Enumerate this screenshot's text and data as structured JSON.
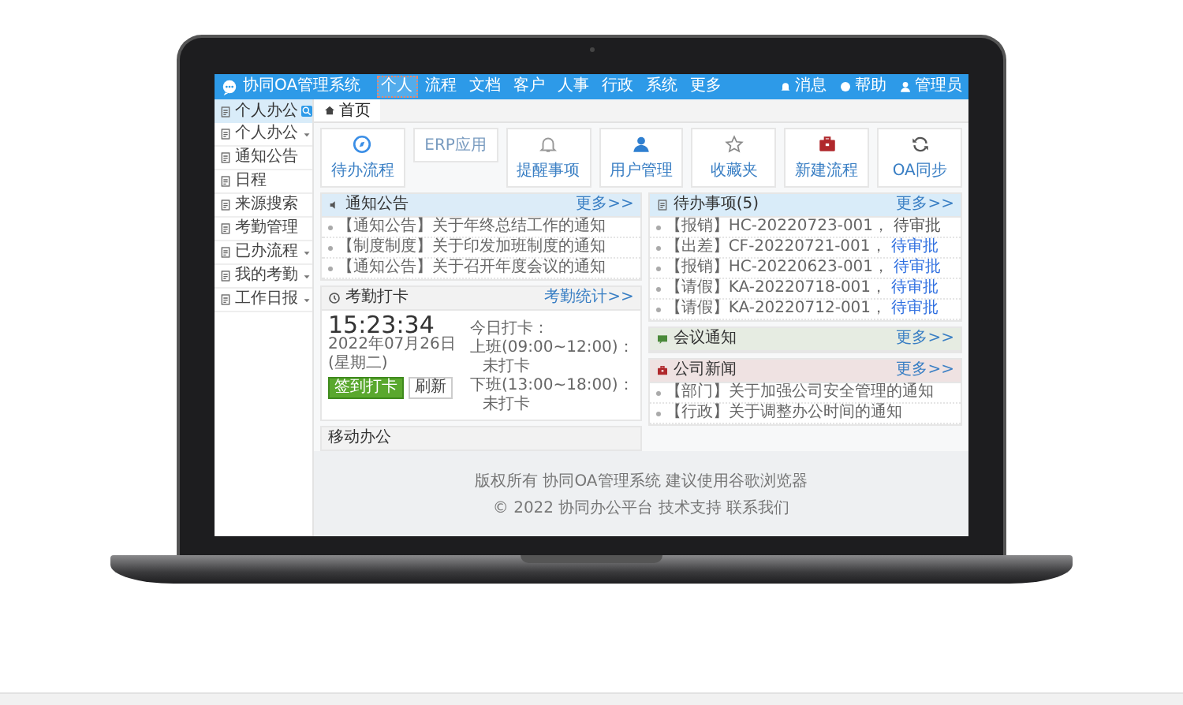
{
  "header": {
    "logo": "协同OA管理系统",
    "nav": [
      {
        "label": "个人",
        "selected": true
      },
      {
        "label": "流程",
        "selected": false
      },
      {
        "label": "文档",
        "selected": false
      },
      {
        "label": "客户",
        "selected": false
      },
      {
        "label": "人事",
        "selected": false
      },
      {
        "label": "行政",
        "selected": false
      },
      {
        "label": "系统",
        "selected": false
      },
      {
        "label": "更多",
        "selected": false
      }
    ],
    "tools": [
      "消息",
      "帮助",
      "管理员"
    ]
  },
  "sidebar": {
    "title": "个人办公",
    "items": [
      {
        "label": "个人办公",
        "expandable": true
      },
      {
        "label": "通知公告",
        "expandable": false
      },
      {
        "label": "日程",
        "expandable": false
      },
      {
        "label": "来源搜索",
        "expandable": false
      },
      {
        "label": "考勤管理",
        "expandable": false
      },
      {
        "label": "已办流程",
        "expandable": true
      },
      {
        "label": "我的考勤",
        "expandable": true
      },
      {
        "label": "工作日报",
        "expandable": true
      }
    ]
  },
  "tabs": [
    {
      "label": "首页",
      "selected": true
    }
  ],
  "shortcuts": [
    {
      "kind": "icon",
      "label": "待办流程"
    },
    {
      "kind": "plain",
      "label": "ERP应用"
    },
    {
      "kind": "icon",
      "label": "提醒事项"
    },
    {
      "kind": "icon",
      "label": "用户管理"
    },
    {
      "kind": "icon",
      "label": "收藏夹"
    },
    {
      "kind": "icon",
      "label": "新建流程"
    },
    {
      "kind": "icon",
      "label": "OA同步"
    }
  ],
  "notices": {
    "title": "通知公告",
    "more": "更多>>",
    "rows": [
      "【通知公告】关于年终总结工作的通知",
      "【制度制度】关于印发加班制度的通知",
      "【通知公告】关于召开年度会议的通知"
    ]
  },
  "punch": {
    "title": "考勤打卡",
    "more": "考勤统计>>",
    "time": "15:23:34",
    "date": "2022年07月26日(星期二)",
    "button": "签到打卡",
    "refresh": "刷新",
    "today": "今日打卡：",
    "shifts": [
      {
        "label": "上班(09:00~12:00)：",
        "status": "未打卡"
      },
      {
        "label": "下班(13:00~18:00)：",
        "status": "未打卡"
      }
    ]
  },
  "mobile": {
    "title": "移动办公"
  },
  "todos": {
    "title": "待办事项(5)",
    "more": "更多>>",
    "rows": [
      {
        "text": "【报销】HC-20220723-001，",
        "status": "待审批",
        "highlighted": false
      },
      {
        "text": "【出差】CF-20220721-001，",
        "status": "待审批",
        "highlighted": true
      },
      {
        "text": "【报销】HC-20220623-001，",
        "status": "待审批",
        "highlighted": true
      },
      {
        "text": "【请假】KA-20220718-001，",
        "status": "待审批",
        "highlighted": true
      },
      {
        "text": "【请假】KA-20220712-001，",
        "status": "待审批",
        "highlighted": true
      }
    ]
  },
  "meetings": {
    "title": "会议通知",
    "more": "更多>>"
  },
  "news": {
    "title": "公司新闻",
    "more": "更多>>",
    "rows": [
      "【部门】关于加强公司安全管理的通知",
      "【行政】关于调整办公时间的通知"
    ]
  },
  "footer": {
    "lines": [
      "版权所有 协同OA管理系统 建议使用谷歌浏览器",
      "© 2022 协同办公平台 技术支持 联系我们"
    ]
  }
}
